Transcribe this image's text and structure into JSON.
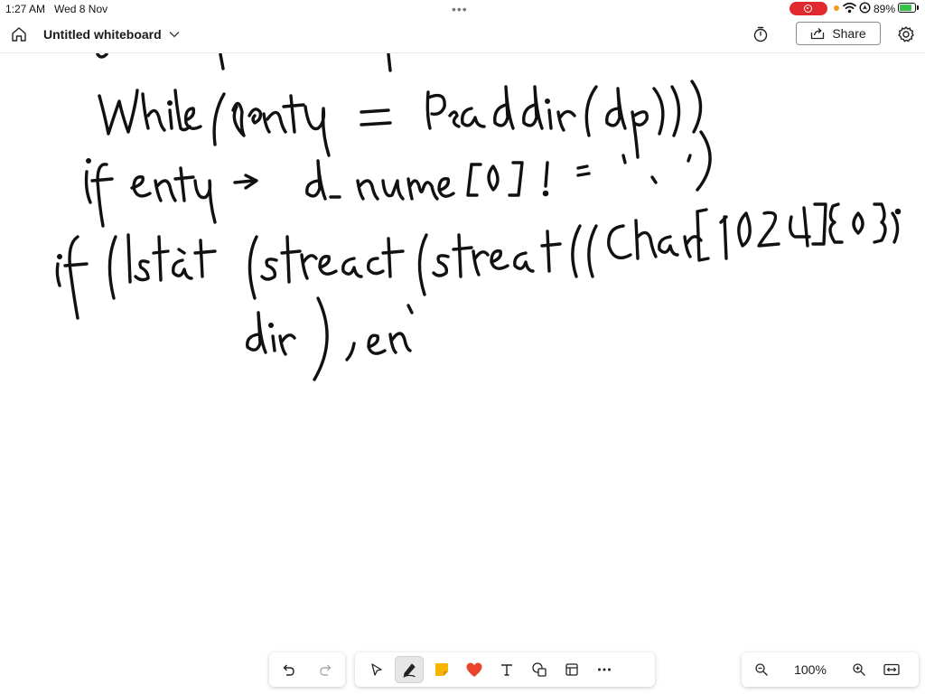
{
  "status_bar": {
    "time": "1:27 AM",
    "date": "Wed 8 Nov",
    "battery": "89%",
    "battery_level": 0.89,
    "icons": [
      "more-dots-icon",
      "screen-record-icon",
      "wifi-icon",
      "location-icon",
      "battery-charging-icon"
    ]
  },
  "header": {
    "title": "Untitled whiteboard",
    "share_label": "Share",
    "icons": [
      "home-icon",
      "chevron-down-icon",
      "timer-icon",
      "share-icon",
      "settings-gear-icon"
    ]
  },
  "canvas": {
    "content": "handwritten ink strokes",
    "ink_color": "#111111"
  },
  "toolbar": {
    "history_icons": [
      "undo-icon",
      "redo-icon"
    ],
    "tools": [
      "select-pointer-icon",
      "pen-icon",
      "sticky-note-icon",
      "reaction-heart-icon",
      "text-icon",
      "shapes-icon",
      "template-icon",
      "more-icon"
    ],
    "active_tool": "pen",
    "zoom_level": "100%",
    "zoom_icons": [
      "zoom-out-icon",
      "zoom-in-icon",
      "fit-screen-icon"
    ]
  },
  "colors": {
    "record": "#e0282e",
    "battery_fill": "#36c24a",
    "sticky_note": "#f7b500",
    "heart": "#e9442c",
    "ink": "#111111"
  }
}
